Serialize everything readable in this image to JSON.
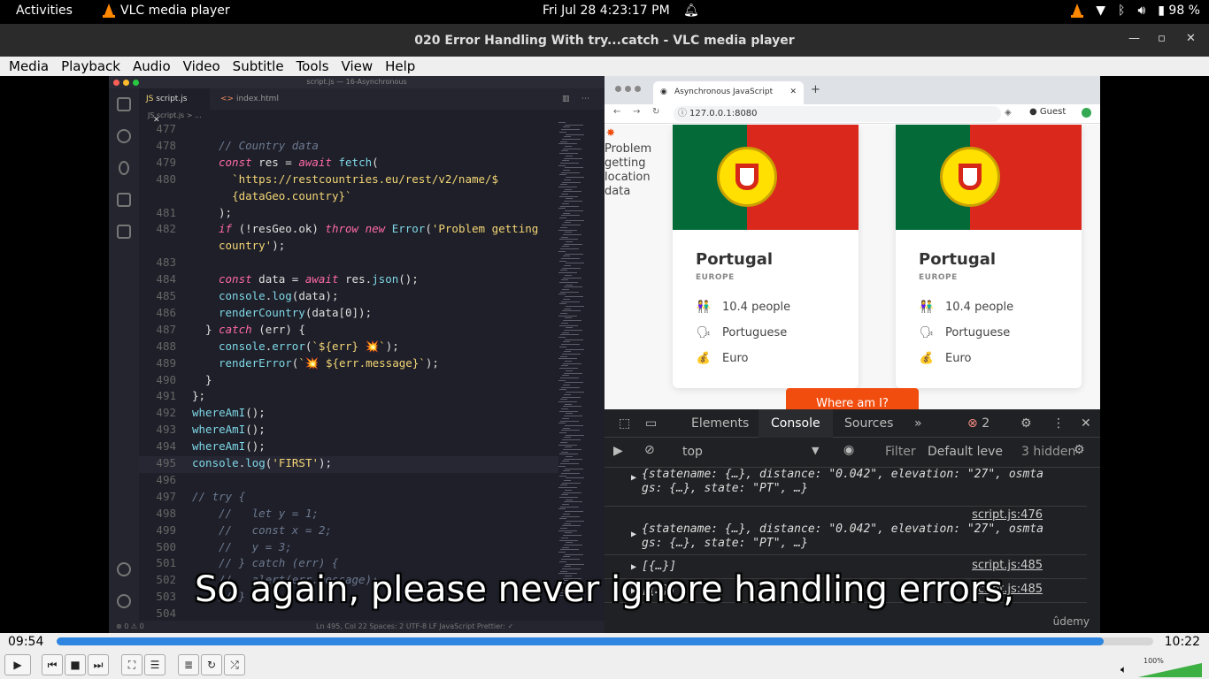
{
  "topbar": {
    "activities": "Activities",
    "app_name": "VLC media player",
    "datetime": "Fri Jul 28   4:23:17 PM",
    "battery": "98 %"
  },
  "window": {
    "title": "020 Error Handling With try...catch - VLC media player"
  },
  "menu": [
    "Media",
    "Playback",
    "Audio",
    "Video",
    "Subtitle",
    "Tools",
    "View",
    "Help"
  ],
  "vscode": {
    "window_title": "script.js — 16-Asynchronous",
    "tabs": [
      "script.js",
      "index.html"
    ],
    "breadcrumb": "JS script.js > ...",
    "status": "Ln 495, Col 22   Spaces: 2   UTF-8   LF   JavaScript   Prettier: ✓",
    "lines": [
      {
        "n": "477",
        "html": ""
      },
      {
        "n": "478",
        "html": "<span class='cm'>// Country data</span>"
      },
      {
        "n": "479",
        "html": "<span class='kw'>const</span> res = <span class='kw'>await</span> <span class='fn'>fetch</span>("
      },
      {
        "n": "480",
        "html": "  <span class='str'>`https://restcountries.eu/rest/v2/name/$</span>"
      },
      {
        "n": "",
        "html": "  <span class='str'>{dataGeo.country}`</span>"
      },
      {
        "n": "481",
        "html": ");"
      },
      {
        "n": "482",
        "html": "<span class='kw'>if</span> (!resGeo.ok) <span class='kw'>throw new</span> <span class='fn'>Error</span>(<span class='str'>'Problem getting</span>"
      },
      {
        "n": "",
        "html": "<span class='str'>country'</span>);"
      },
      {
        "n": "483",
        "html": ""
      },
      {
        "n": "484",
        "html": "<span class='kw'>const</span> data = <span class='kw'>await</span> res.<span class='fn'>json</span>();"
      },
      {
        "n": "485",
        "html": "<span class='fn'>console</span>.<span class='fn'>log</span>(data);"
      },
      {
        "n": "486",
        "html": "<span class='fn'>renderCountry</span>(data[0]);"
      },
      {
        "n": "487",
        "html": "} <span class='kw'>catch</span> (err) {"
      },
      {
        "n": "488",
        "html": "<span class='fn'>console</span>.<span class='fn'>error</span>(<span class='str'>`${err} 💥`</span>);"
      },
      {
        "n": "489",
        "html": "<span class='fn'>renderError</span>(<span class='str'>`💥 ${err.message}`</span>);"
      },
      {
        "n": "490",
        "html": "}"
      },
      {
        "n": "491",
        "html": "};"
      },
      {
        "n": "492",
        "html": "<span class='fn'>whereAmI</span>();"
      },
      {
        "n": "493",
        "html": "<span class='fn'>whereAmI</span>();"
      },
      {
        "n": "494",
        "html": "<span class='fn'>whereAmI</span>();"
      },
      {
        "n": "495",
        "html": "<span class='fn'>console</span>.<span class='fn'>log</span>(<span class='str'>'FIRST'</span>);"
      },
      {
        "n": "496",
        "html": ""
      },
      {
        "n": "497",
        "html": "<span class='cm'>// try {</span>"
      },
      {
        "n": "498",
        "html": "<span class='cm'>//   let y = 1;</span>"
      },
      {
        "n": "499",
        "html": "<span class='cm'>//   const x = 2;</span>"
      },
      {
        "n": "500",
        "html": "<span class='cm'>//   y = 3;</span>"
      },
      {
        "n": "501",
        "html": "<span class='cm'>// } catch (err) {</span>"
      },
      {
        "n": "502",
        "html": "<span class='cm'>//   alert(err.message);</span>"
      },
      {
        "n": "503",
        "html": "<span class='cm'>// }</span>"
      },
      {
        "n": "504",
        "html": ""
      }
    ]
  },
  "chrome": {
    "tab_title": "Asynchronous JavaScript",
    "url": "127.0.0.1:8080",
    "profile": "Guest",
    "error_text": "Problem getting location data",
    "cards": [
      {
        "name": "Portugal",
        "region": "EUROPE",
        "population": "10.4 people",
        "language": "Portuguese",
        "currency": "Euro"
      },
      {
        "name": "Portugal",
        "region": "EUROPE",
        "population": "10.4 people",
        "language": "Portuguese",
        "currency": "Euro"
      }
    ],
    "button": "Where am I?",
    "devtools": {
      "tabs": [
        "Elements",
        "Console",
        "Sources",
        "»"
      ],
      "error_count": "2",
      "context": "top",
      "filter_placeholder": "Filter",
      "levels": "Default leve",
      "hidden": "3 hidden",
      "logs": [
        {
          "text": "{statename: {…}, distance: \"0.042\", elevation: \"27\", osmta gs: {…}, state: \"PT\", …}",
          "source": ""
        },
        {
          "text": "{statename: {…}, distance: \"0.042\", elevation: \"27\", osmta gs: {…}, state: \"PT\", …}",
          "source": "script.js:476"
        },
        {
          "text": "[{…}]",
          "source": "script.js:485"
        },
        {
          "text": "[{…}]",
          "source": "script.js:485"
        }
      ]
    },
    "watermark": "ûdemy"
  },
  "subtitle": "So again, please never ignore handling errors,",
  "player": {
    "elapsed": "09:54",
    "total": "10:22",
    "progress": 0.955,
    "volume": "100%"
  }
}
